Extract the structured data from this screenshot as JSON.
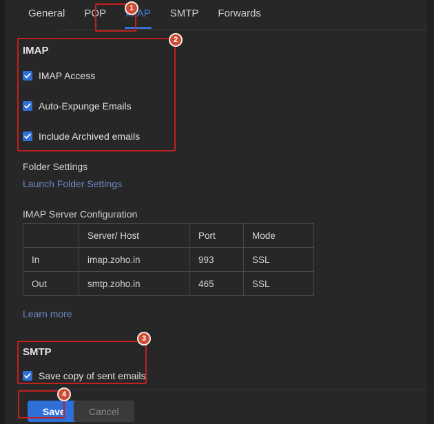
{
  "window": {
    "background": "#272727",
    "accent_blue": "#2f6fd8",
    "link_blue": "#6d8bc8",
    "annotation_red": "#c0201f",
    "badge_orange": "#cf4a32"
  },
  "tabs": [
    {
      "label": "General",
      "active": false
    },
    {
      "label": "POP",
      "active": false
    },
    {
      "label": "IMAP",
      "active": true
    },
    {
      "label": "SMTP",
      "active": false
    },
    {
      "label": "Forwards",
      "active": false
    }
  ],
  "imap_section": {
    "heading": "IMAP",
    "checkboxes": [
      {
        "label": "IMAP Access",
        "checked": true
      },
      {
        "label": "Auto-Expunge Emails",
        "checked": true
      },
      {
        "label": "Include Archived emails",
        "checked": true
      }
    ]
  },
  "folder_settings": {
    "heading": "Folder Settings",
    "link_label": "Launch Folder Settings"
  },
  "server_config": {
    "heading": "IMAP Server Configuration",
    "columns": [
      "",
      "Server/ Host",
      "Port",
      "Mode"
    ],
    "rows": [
      {
        "direction": "In",
        "host": "imap.zoho.in",
        "port": "993",
        "mode": "SSL"
      },
      {
        "direction": "Out",
        "host": "smtp.zoho.in",
        "port": "465",
        "mode": "SSL"
      }
    ],
    "learn_more_label": "Learn more"
  },
  "smtp_section": {
    "heading": "SMTP",
    "checkbox": {
      "label": "Save copy of sent emails",
      "checked": true
    }
  },
  "actions": {
    "save_label": "Save",
    "cancel_label": "Cancel"
  },
  "annotations": [
    {
      "number": "1",
      "target": "imap-tab"
    },
    {
      "number": "2",
      "target": "imap-options-section"
    },
    {
      "number": "3",
      "target": "smtp-section"
    },
    {
      "number": "4",
      "target": "save-button"
    }
  ]
}
